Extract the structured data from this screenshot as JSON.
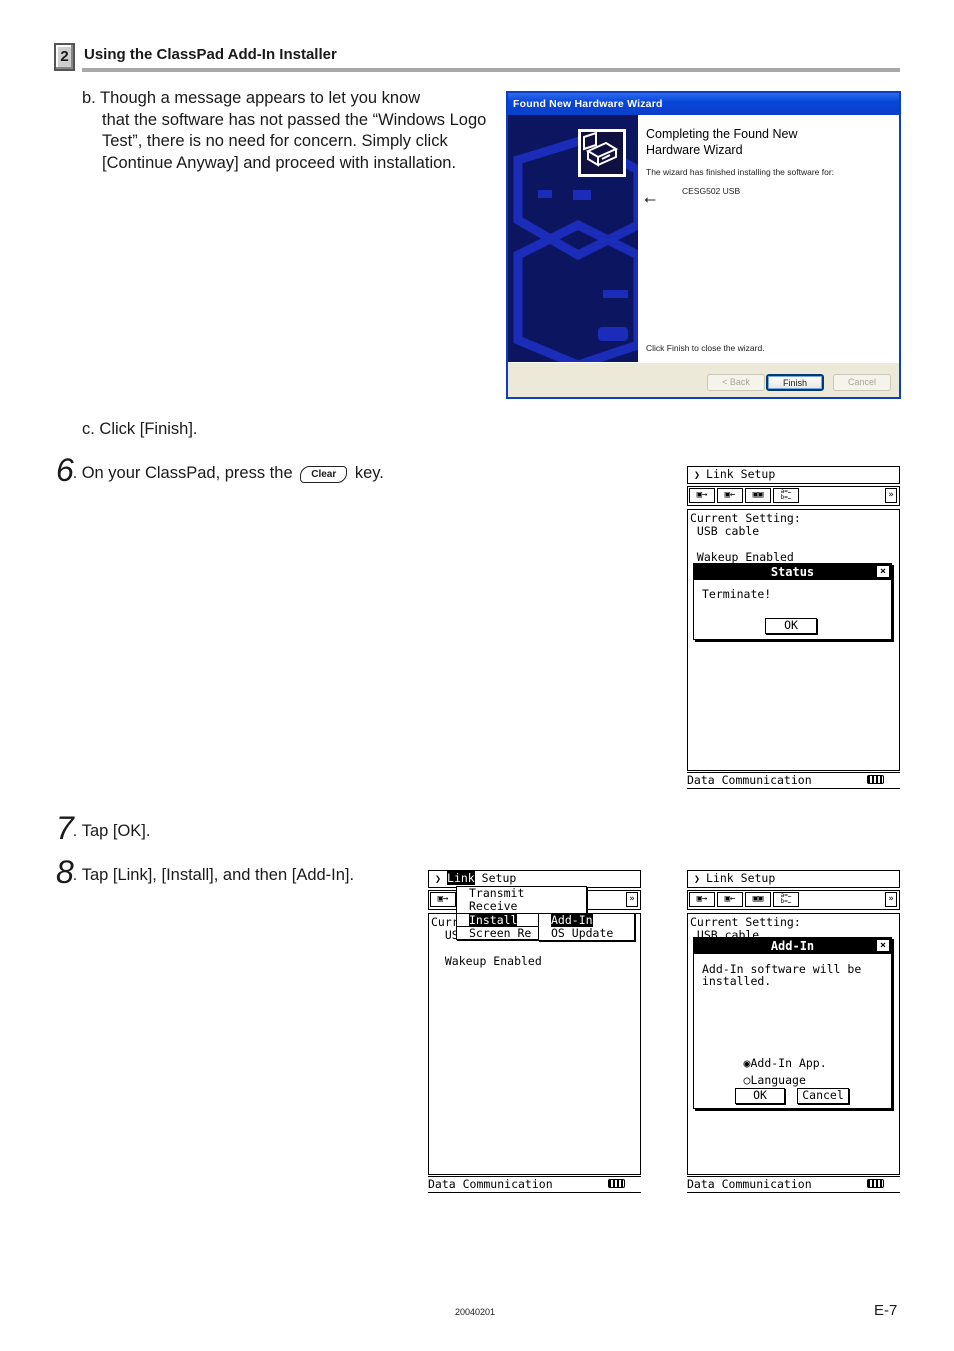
{
  "header": {
    "section_number": "2",
    "title": "Using the ClassPad Add-In Installer"
  },
  "step_b": {
    "first_line": "b. Though a message appears to let you know",
    "rest": "that the software has not passed the “Windows Logo Test”, there is no need for concern. Simply click [Continue Anyway] and proceed with installation."
  },
  "wizard": {
    "title": "Found New Hardware Wizard",
    "heading_line1": "Completing the Found New",
    "heading_line2": "Hardware Wizard",
    "subtitle": "The wizard has finished installing the software for:",
    "device_icon": "usb-icon",
    "device_name": "CESG502 USB",
    "close_hint": "Click Finish to close the wizard.",
    "buttons": {
      "back": "< Back",
      "finish": "Finish",
      "cancel": "Cancel"
    }
  },
  "step_c": "c. Click [Finish].",
  "step6": {
    "number": "6",
    "text_before": "On your ClassPad, press the",
    "key_label": "Clear",
    "text_after": "key."
  },
  "step7": {
    "number": "7",
    "text": "Tap [OK]."
  },
  "step8": {
    "number": "8",
    "text": "Tap [Link], [Install], and then [Add-In]."
  },
  "screen1": {
    "menu_chevron": "✔",
    "menu_title": "Link Setup",
    "toolbar": [
      "▣→",
      "▣←",
      "▣▣",
      "a=… b=…",
      "»"
    ],
    "body_lines": "Current Setting:\n USB cable\n\n Wakeup Enabled",
    "dialog_title": "Status",
    "dialog_close": "×",
    "dialog_text": "Terminate!",
    "ok": "OK",
    "status_bar": "Data Communication"
  },
  "screen2": {
    "menu_link": "Link",
    "menu_rest": "Setup",
    "toolbar_first": "▣→",
    "toolbar_last": "»",
    "body_lines": "Curr\n  US\n\n  Wakeup Enabled",
    "dropdown": [
      "Transmit",
      "Receive",
      "Install",
      "Screen Re"
    ],
    "submenu": [
      "Add-In",
      "OS Update"
    ],
    "status_bar": "Data Communication"
  },
  "screen3": {
    "menu_title": "Link Setup",
    "body_lines": "Current Setting:\n USB cable",
    "dialog_title": "Add-In",
    "dialog_close": "×",
    "dialog_text": "Add-In software will be\ninstalled.",
    "radio_options": [
      {
        "label": "Add-In App.",
        "selected": true
      },
      {
        "label": "Language",
        "selected": false
      }
    ],
    "ok": "OK",
    "cancel": "Cancel",
    "status_bar": "Data Communication"
  },
  "footer": {
    "code": "20040201",
    "page": "E-7"
  }
}
